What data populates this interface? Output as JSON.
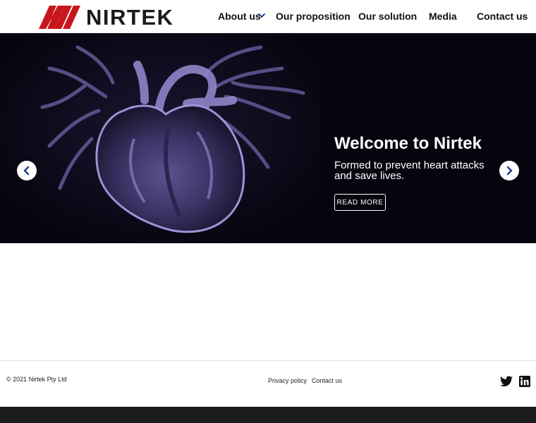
{
  "brand": {
    "name": "NIRTEK",
    "accent": "#c8161d"
  },
  "nav": {
    "items": [
      "About us",
      "Our proposition",
      "Our solution",
      "Media",
      "Contact us"
    ],
    "about_icon": "chevron-down-icon"
  },
  "hero": {
    "title": "Welcome to Nirtek",
    "subtitle": "Formed to prevent heart attacks and save lives.",
    "button": "READ MORE",
    "slide_count": 2,
    "active_slide": 1,
    "prev_icon": "chevron-left-icon",
    "next_icon": "chevron-right-icon",
    "pause_icon": "pause-icon",
    "image": "heart-xray-image"
  },
  "footer": {
    "copyright": "© 2021 Nirtek Pty Ltd",
    "links": [
      "Privacy policy",
      "Contact us"
    ],
    "social": [
      "twitter-icon",
      "linkedin-icon"
    ]
  },
  "colors": {
    "hero_bg": "#07040f",
    "heart": "#8b7fc8",
    "nav_chevron": "#1d3f8c"
  }
}
